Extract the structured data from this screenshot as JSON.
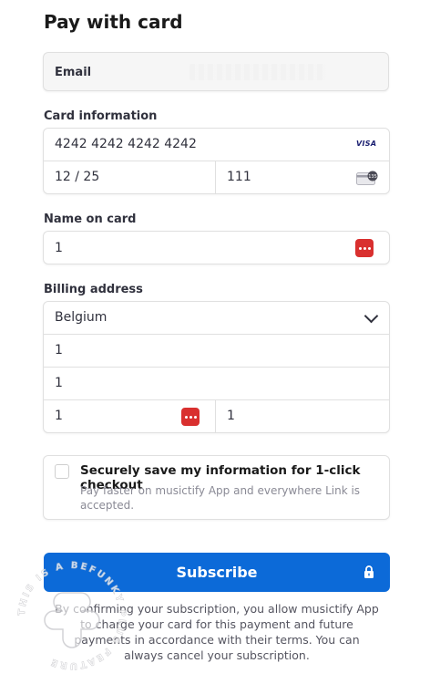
{
  "title": "Pay with card",
  "email": {
    "label": "Email"
  },
  "card": {
    "section_label": "Card information",
    "number": "4242 4242 4242 4242",
    "brand_icon": "visa-icon",
    "brand_text": "VISA",
    "expiry": "12 / 25",
    "cvc": "111",
    "cvc_icon": "card-cvc-icon",
    "cvc_icon_text": "135"
  },
  "name": {
    "section_label": "Name on card",
    "value": "1"
  },
  "billing": {
    "section_label": "Billing address",
    "country": "Belgium",
    "line1": "1",
    "line2": "1",
    "postal": "1",
    "city": "1"
  },
  "save": {
    "title": "Securely save my information for 1-click checkout",
    "description": "Pay faster on musictify App and everywhere Link is accepted."
  },
  "subscribe": {
    "label": "Subscribe"
  },
  "terms": "By confirming your subscription, you allow musictify App to charge your card for this payment and future payments in accordance with their terms. You can always cancel your subscription.",
  "watermark": {
    "text": "THIS IS A BEFUNKY PLUS FEATURE"
  },
  "colors": {
    "accent": "#0c6ad8",
    "autofill_icon": "#d9302f",
    "border": "#e0e0e0"
  }
}
